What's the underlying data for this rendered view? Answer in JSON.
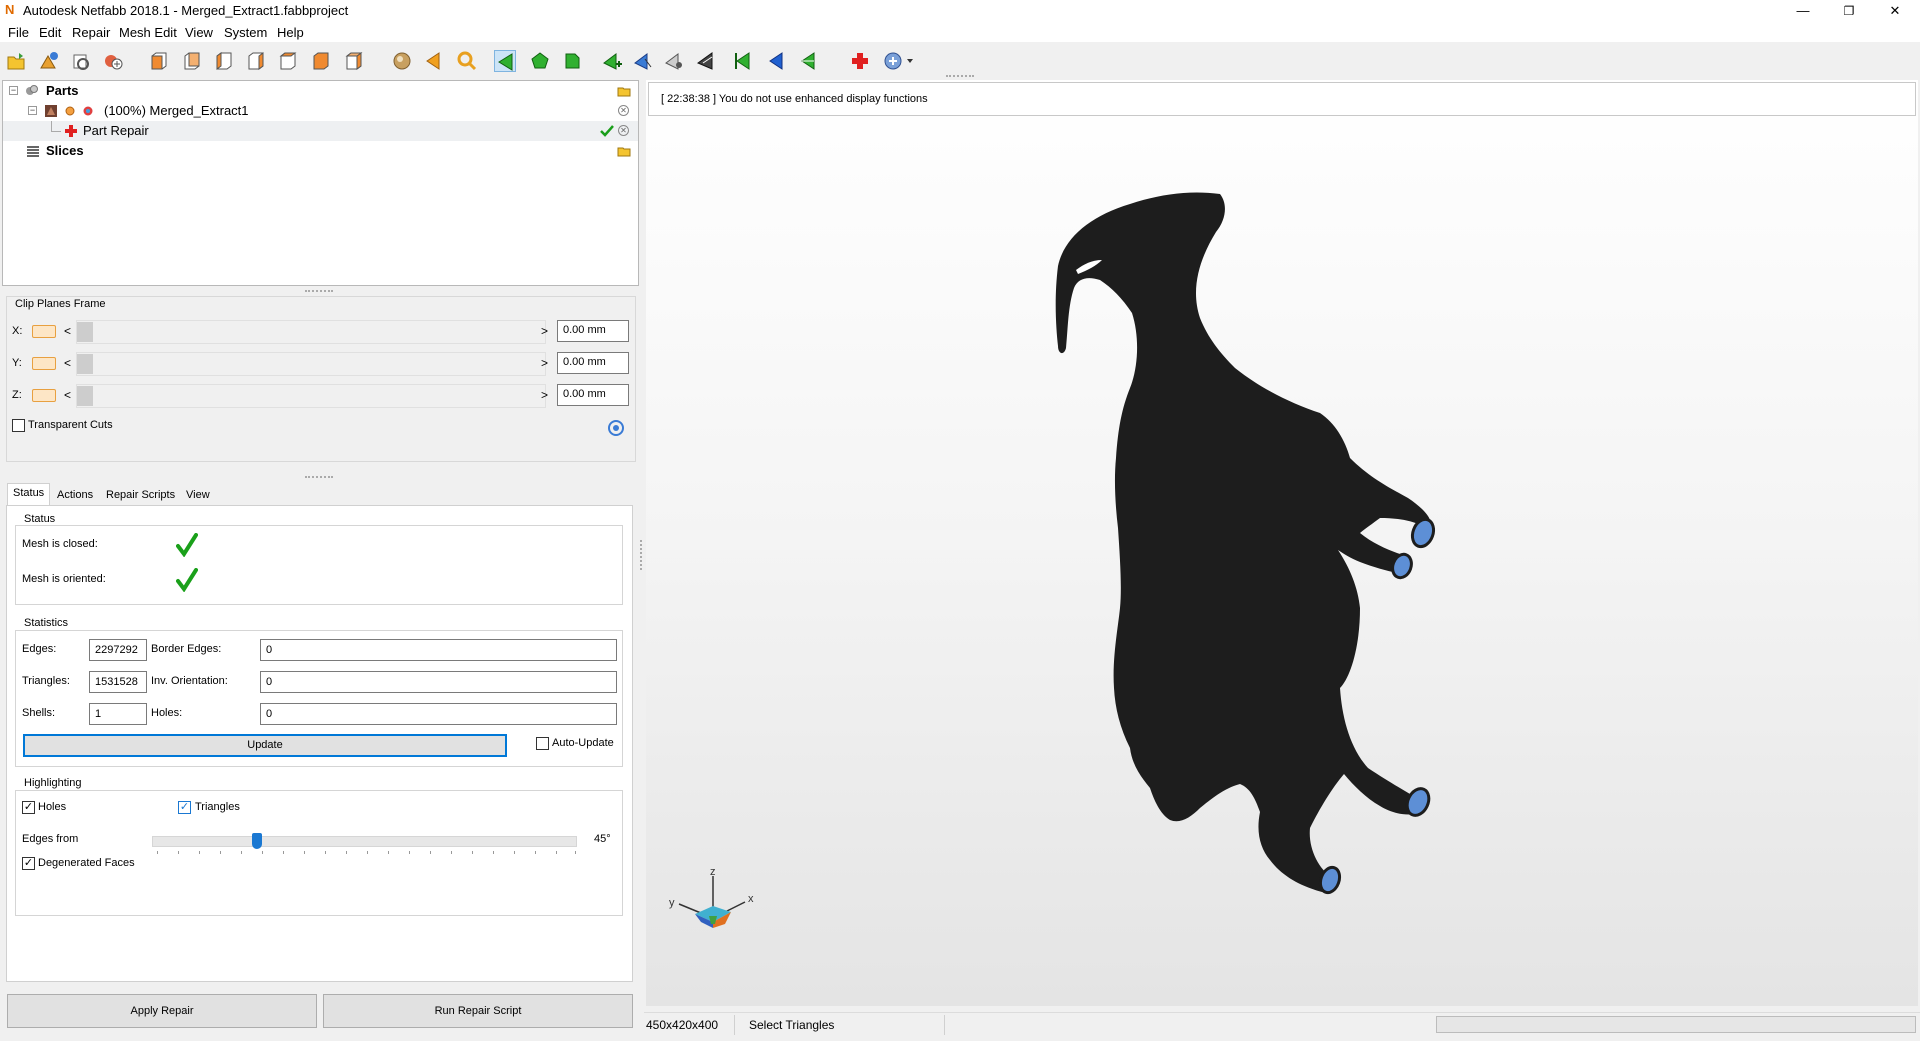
{
  "window": {
    "title": "Autodesk Netfabb 2018.1 - Merged_Extract1.fabbproject",
    "minimize": "—",
    "restore": "❐",
    "close": "✕"
  },
  "menu": [
    "File",
    "Edit",
    "Repair",
    "Mesh Edit",
    "View",
    "System",
    "Help"
  ],
  "toolbar": {
    "icons": [
      "open-project-icon",
      "add-part-icon",
      "add-part-settings-icon",
      "add-platform-icon",
      "view-front-icon",
      "view-back-icon",
      "view-left-icon",
      "view-right-icon",
      "view-top-icon",
      "view-bottom-icon",
      "view-iso-icon",
      "sphere-icon",
      "arrow-left-icon",
      "zoom-icon",
      "select-triangles-icon",
      "select-surface-icon",
      "select-shell-icon",
      "add-triangle-icon",
      "select-by-plane-icon",
      "select-brush-icon",
      "select-all-icon",
      "invert-left-icon",
      "invert-blue-icon",
      "invert-green-icon",
      "repair-icon",
      "support-dropdown-icon"
    ]
  },
  "tree": {
    "parts_label": "Parts",
    "part_name": "(100%) Merged_Extract1",
    "repair_label": "Part Repair",
    "slices_label": "Slices"
  },
  "clip_planes": {
    "title": "Clip Planes Frame",
    "rows": [
      {
        "axis": "X:",
        "value": "0.00 mm"
      },
      {
        "axis": "Y:",
        "value": "0.00 mm"
      },
      {
        "axis": "Z:",
        "value": "0.00 mm"
      }
    ],
    "left_arrow": "<",
    "right_arrow": ">",
    "transparent_cuts": "Transparent Cuts"
  },
  "tabs": [
    "Status",
    "Actions",
    "Repair Scripts",
    "View"
  ],
  "status": {
    "title": "Status",
    "mesh_closed": "Mesh is closed:",
    "mesh_oriented": "Mesh is oriented:"
  },
  "statistics": {
    "title": "Statistics",
    "edges_label": "Edges:",
    "edges": "2297292",
    "border_edges_label": "Border Edges:",
    "border_edges": "0",
    "triangles_label": "Triangles:",
    "triangles": "1531528",
    "inv_orientation_label": "Inv. Orientation:",
    "inv_orientation": "0",
    "shells_label": "Shells:",
    "shells": "1",
    "holes_label": "Holes:",
    "holes": "0",
    "update": "Update",
    "auto_update": "Auto-Update"
  },
  "highlighting": {
    "title": "Highlighting",
    "holes": "Holes",
    "triangles": "Triangles",
    "edges_from": "Edges from",
    "edges_from_value": "45°",
    "degenerated_faces": "Degenerated Faces"
  },
  "buttons": {
    "apply_repair": "Apply Repair",
    "run_repair_script": "Run Repair Script"
  },
  "viewport": {
    "message": "[ 22:38:38 ] You do not use enhanced display functions",
    "axis_x": "x",
    "axis_y": "y",
    "axis_z": "z"
  },
  "statusbar": {
    "dimensions": "450x420x400",
    "mode": "Select Triangles"
  }
}
